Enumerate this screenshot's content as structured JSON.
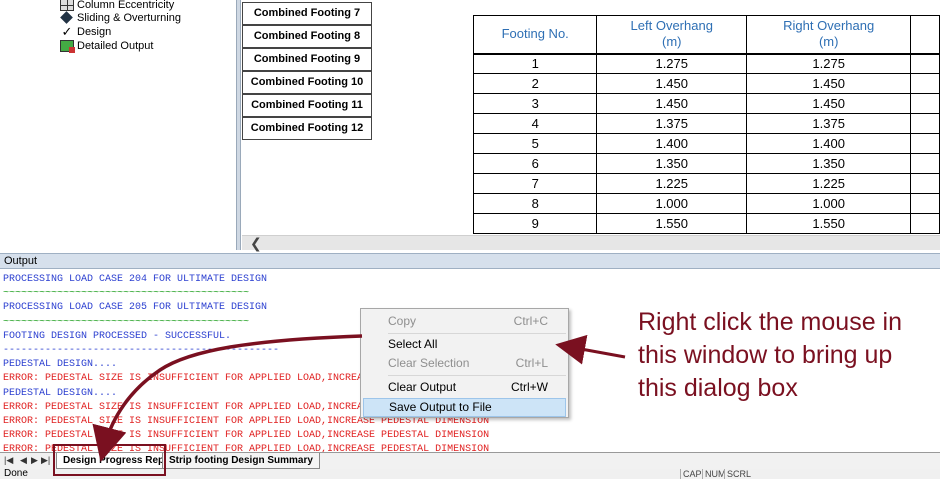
{
  "tree": {
    "items": [
      {
        "label": "Column Eccentricity",
        "icon": "grid-icon"
      },
      {
        "label": "Sliding & Overturning",
        "icon": "slide-icon"
      },
      {
        "label": "Design",
        "icon": "check-icon"
      },
      {
        "label": "Detailed Output",
        "icon": "output-icon"
      }
    ]
  },
  "footing_buttons": [
    "Combined Footing 7",
    "Combined Footing 8",
    "Combined Footing 9",
    "Combined Footing 10",
    "Combined Footing 11",
    "Combined Footing 12"
  ],
  "table": {
    "headers": [
      "Footing No.",
      "Left Overhang\n(m)",
      "Right Overhang\n(m)"
    ],
    "rows": [
      [
        "1",
        "1.275",
        "1.275"
      ],
      [
        "2",
        "1.450",
        "1.450"
      ],
      [
        "3",
        "1.450",
        "1.450"
      ],
      [
        "4",
        "1.375",
        "1.375"
      ],
      [
        "5",
        "1.400",
        "1.400"
      ],
      [
        "6",
        "1.350",
        "1.350"
      ],
      [
        "7",
        "1.225",
        "1.225"
      ],
      [
        "8",
        "1.000",
        "1.000"
      ],
      [
        "9",
        "1.550",
        "1.550"
      ]
    ]
  },
  "output": {
    "title": "Output",
    "lines": [
      {
        "text": "PROCESSING LOAD CASE 204 FOR ULTIMATE DESIGN",
        "color": "blue"
      },
      {
        "text": "~~~~~~~~~~~~~~~~~~~~~~~~~~~~~~~~~~~~~~~~~",
        "color": "green"
      },
      {
        "text": "PROCESSING LOAD CASE 205 FOR ULTIMATE DESIGN",
        "color": "blue"
      },
      {
        "text": "~~~~~~~~~~~~~~~~~~~~~~~~~~~~~~~~~~~~~~~~~",
        "color": "green"
      },
      {
        "text": "FOOTING DESIGN PROCESSED - SUCCESSFUL.",
        "color": "blue"
      },
      {
        "text": "----------------------------------------------",
        "color": "blue"
      },
      {
        "text": "PEDESTAL DESIGN....",
        "color": "blue"
      },
      {
        "text": "ERROR: PEDESTAL SIZE IS INSUFFICIENT FOR APPLIED LOAD,INCREASE PEDESTAL DIMENSION",
        "color": "red"
      },
      {
        "text": "PEDESTAL DESIGN....",
        "color": "blue"
      },
      {
        "text": "ERROR: PEDESTAL SIZE IS INSUFFICIENT FOR APPLIED LOAD,INCREASE PEDESTAL DIMENSION",
        "color": "red"
      },
      {
        "text": "ERROR: PEDESTAL SIZE IS INSUFFICIENT FOR APPLIED LOAD,INCREASE PEDESTAL DIMENSION",
        "color": "red"
      },
      {
        "text": "ERROR: PEDESTAL SIZE IS INSUFFICIENT FOR APPLIED LOAD,INCREASE PEDESTAL DIMENSION",
        "color": "red"
      },
      {
        "text": "ERROR: PEDESTAL SIZE IS INSUFFICIENT FOR APPLIED LOAD,INCREASE PEDESTAL DIMENSION",
        "color": "red"
      },
      {
        "text": "ERROR: PEDESTAL SIZE IS INSUFFICIENT FOR APPLIED LOAD,INCREASE PEDESTAL DIMENSION",
        "color": "red"
      }
    ]
  },
  "tabs": [
    "Design Progress Report",
    "Strip footing Design Summary"
  ],
  "status": {
    "text": "Done",
    "indicators": [
      "CAP",
      "NUM",
      "SCRL"
    ]
  },
  "context_menu": {
    "items": [
      {
        "label": "Copy",
        "shortcut": "Ctrl+C",
        "disabled": true
      },
      {
        "label": "Select All",
        "shortcut": "",
        "disabled": false
      },
      {
        "label": "Clear Selection",
        "shortcut": "Ctrl+L",
        "disabled": true
      },
      {
        "label": "Clear Output",
        "shortcut": "Ctrl+W",
        "disabled": false
      },
      {
        "label": "Save Output to File",
        "shortcut": "",
        "disabled": false,
        "highlighted": true
      }
    ]
  },
  "callout": "Right click the mouse in this window to bring up this dialog box",
  "colors": {
    "annotation": "#7a1020",
    "header_text": "#2e6fb4",
    "info_text": "#2b3fd0",
    "error_text": "#e02020",
    "rule_text": "#1c9e1c"
  }
}
